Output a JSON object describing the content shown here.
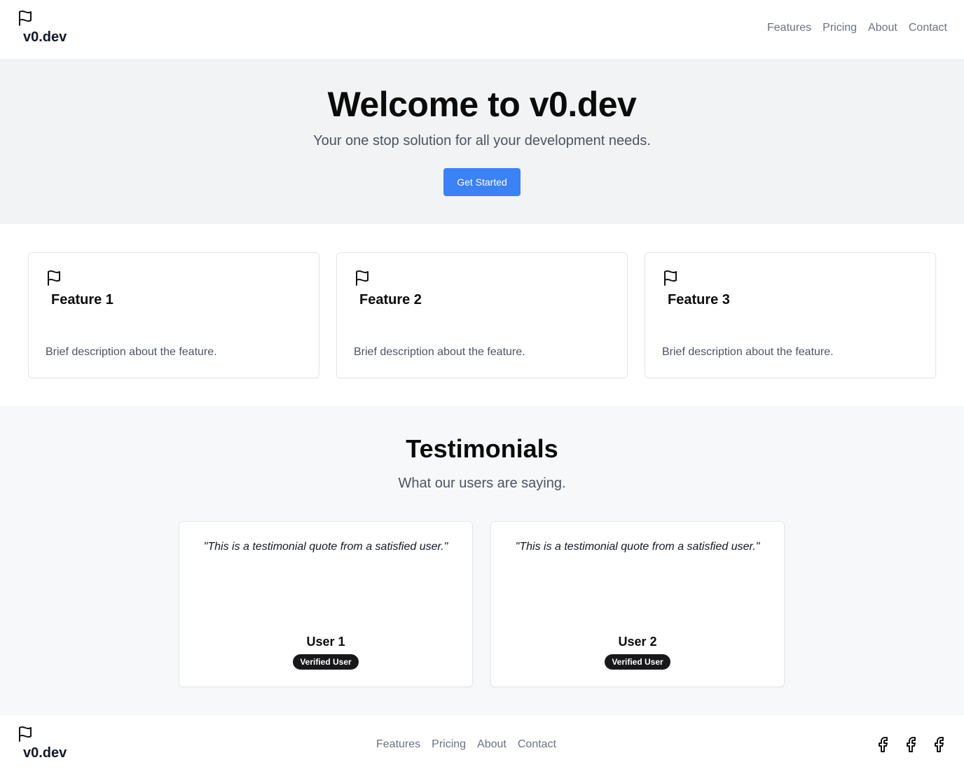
{
  "header": {
    "brand": "v0.dev",
    "brand_icon": "flag-icon",
    "nav": [
      "Features",
      "Pricing",
      "About",
      "Contact"
    ]
  },
  "hero": {
    "title": "Welcome to v0.dev",
    "subtitle": "Your one stop solution for all your development needs.",
    "cta": "Get Started"
  },
  "features": [
    {
      "icon": "flag-icon",
      "title": "Feature 1",
      "description": "Brief description about the feature."
    },
    {
      "icon": "flag-icon",
      "title": "Feature 2",
      "description": "Brief description about the feature."
    },
    {
      "icon": "flag-icon",
      "title": "Feature 3",
      "description": "Brief description about the feature."
    }
  ],
  "testimonials": {
    "title": "Testimonials",
    "subtitle": "What our users are saying.",
    "items": [
      {
        "quote": "\"This is a testimonial quote from a satisfied user.\"",
        "user": "User 1",
        "badge": "Verified User"
      },
      {
        "quote": "\"This is a testimonial quote from a satisfied user.\"",
        "user": "User 2",
        "badge": "Verified User"
      }
    ]
  },
  "footer": {
    "brand": "v0.dev",
    "nav": [
      "Features",
      "Pricing",
      "About",
      "Contact"
    ],
    "social_icons": [
      "facebook-icon",
      "facebook-icon",
      "facebook-icon"
    ]
  },
  "colors": {
    "accent": "#3b82f6",
    "hero_bg": "#f2f3f4",
    "testimonials_bg": "#f7f8f9",
    "badge_bg": "#18181b"
  }
}
